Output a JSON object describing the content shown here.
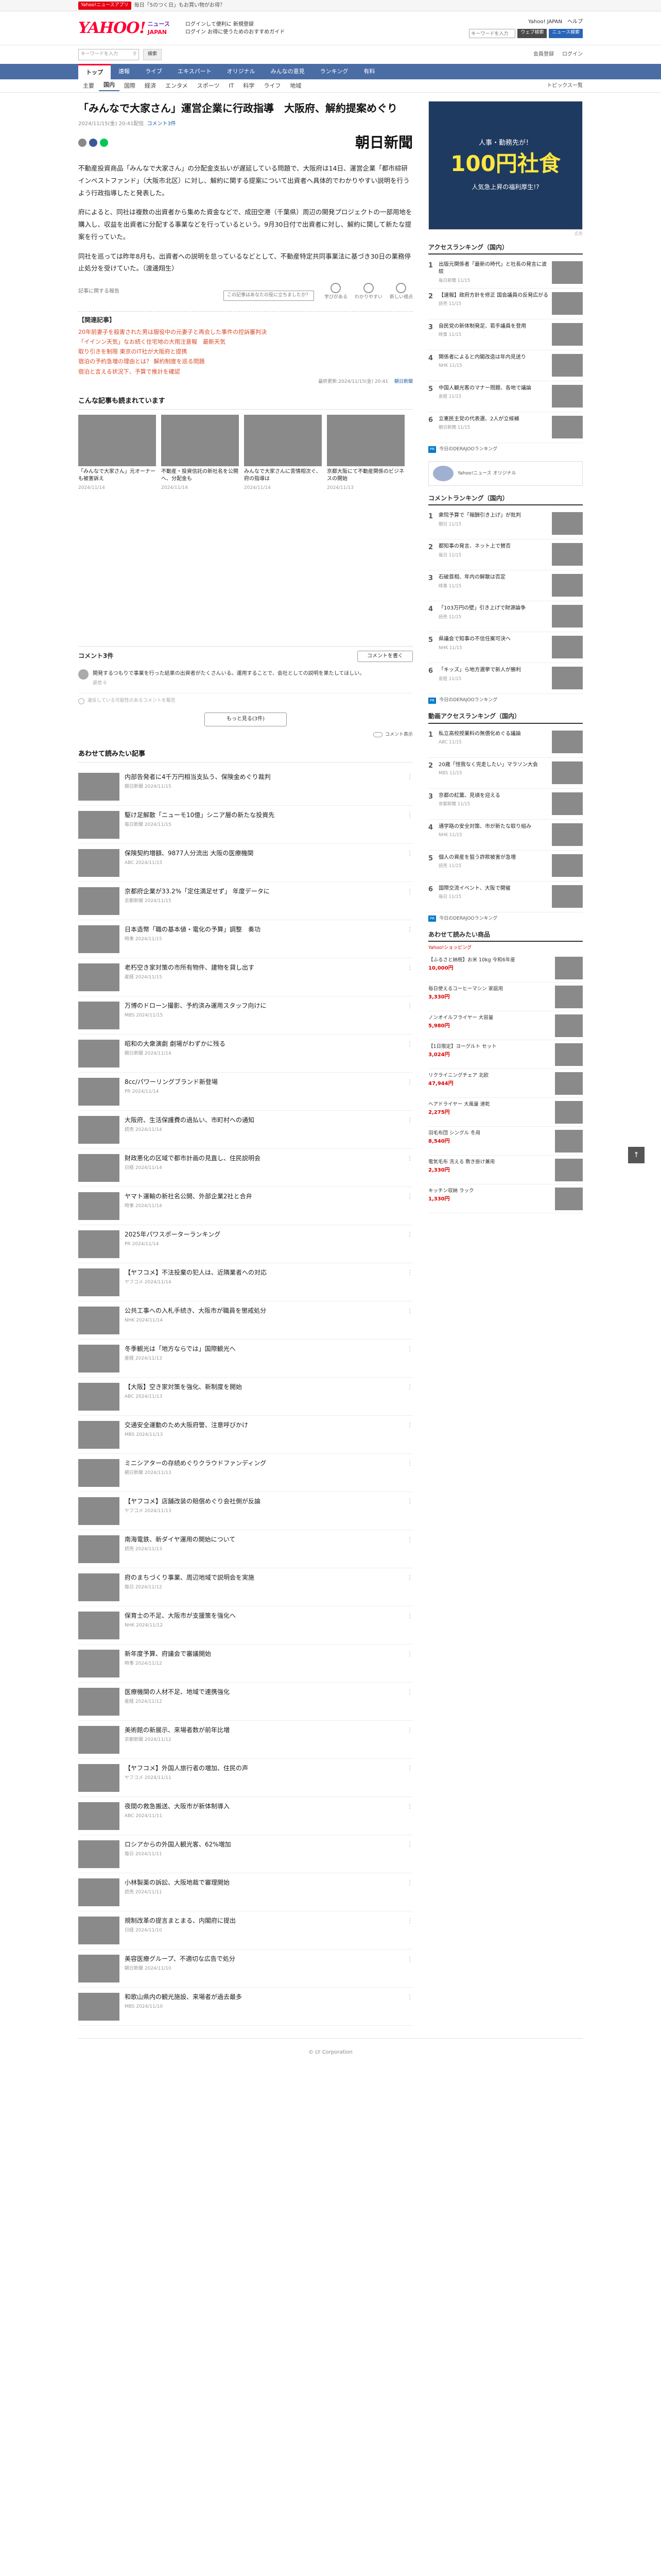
{
  "topbar": {
    "badge": "Yahoo!ニュースアプリ",
    "promo": "毎日「5のつく日」もお買い物がお得？"
  },
  "header": {
    "logo": "YAHOO!",
    "logo_sub1": "ニュース",
    "logo_sub2": "JAPAN",
    "mid_line1": "ログインして便利に 新規登録",
    "mid_line2": "ログイン  お得に使うためのおすすめガイド",
    "links": [
      "Yahoo! JAPAN",
      "ヘルプ"
    ],
    "search_placeholder": "キーワードを入力",
    "search_web": "ウェブ検索",
    "search_news": "ニュース検索"
  },
  "searchrow": {
    "placeholder": "キーワードを入力",
    "button": "検索",
    "right": [
      "会員登録",
      "ログイン"
    ]
  },
  "nav": [
    "トップ",
    "速報",
    "ライブ",
    "エキスパート",
    "オリジナル",
    "みんなの意見",
    "ランキング",
    "有料"
  ],
  "subnav": [
    "主要",
    "国内",
    "国際",
    "経済",
    "エンタメ",
    "スポーツ",
    "IT",
    "科学",
    "ライフ",
    "地域"
  ],
  "subnav_right": "トピックス一覧",
  "article": {
    "title": "「みんなで大家さん」運営企業に行政指導　大阪府、解約提案めぐり",
    "time": "2024/11/15(金) 20:41配信",
    "comments": "コメント3件",
    "publisher": "朝日新聞",
    "paragraphs": [
      "不動産投資商品「みんなで大家さん」の分配金支払いが遅延している問題で、大阪府は14日、運営企業「都市綜研インベストファンド」（大阪市北区）に対し、解約に関する提案について出資者へ具体的でわかりやすい説明を行うよう行政指導したと発表した。",
      "府によると、同社は複数の出資者から集めた資金などで、成田空港（千葉県）周辺の開発プロジェクトの一部用地を購入し、収益を出資者に分配する事業などを行っているという。9月30日付で出資者に対し、解約に関して新たな提案を行っていた。",
      "同社を巡っては昨年8月も、出資者への説明を怠っているなどとして、不動産特定共同事業法に基づき30日の業務停止処分を受けていた。（渡邊翔生）"
    ],
    "byline": "朝日新聞社",
    "tool": "記事に関する報告",
    "tooltip": "この記事はあなたの役に立ちましたか？",
    "reactions": [
      "学びがある",
      "わかりやすい",
      "新しい視点"
    ],
    "related_title": "【関連記事】",
    "related": [
      "20年前妻子を殺害された男は服役中の元妻子と再会した事件の控訴審判決",
      "「イインン天気」なお続く住宅地の大雨注意報　最新天気",
      "取り引きを制限 東京のIT社が大阪府と提携",
      "宿泊の予約急増の理由とは？ 解約制度を巡る問題",
      "宿泊と言える状況下、予算で推計を確認"
    ],
    "related_date": "最終更新:2024/11/15(金) 20:41",
    "related_pub": "朝日新聞"
  },
  "recommend": {
    "title": "こんな記事も読まれています",
    "cards": [
      {
        "t": "「みんなで大家さん」元オーナーも被害訴え",
        "m": "2024/11/14"
      },
      {
        "t": "不動産・投資信託の新社名を公開へ、分配金も",
        "m": "2024/11/14"
      },
      {
        "t": "みんなで大家さんに苦情相次ぐ、府の指導は",
        "m": "2024/11/14"
      },
      {
        "t": "京都大阪にて不動産関係のビジネスの開始",
        "m": "2024/11/13"
      }
    ]
  },
  "comments": {
    "title": "コメント3件",
    "button": "コメントを書く",
    "item": "開発するつもりで事業を行った結果の出資者がたくさんいる。運用することで、会社としての説明を果たしてほしい。",
    "item_meta": "返信 0",
    "more": "もっと見る(3件)",
    "note": "違反している可能性のあるコメントを報告",
    "toggle": "コメント表示"
  },
  "feed": {
    "title": "あわせて読みたい記事",
    "items": [
      {
        "t": "内部告発者に4千万円相当支払う、保険金めぐり裁判",
        "m": "朝日新聞 2024/11/15"
      },
      {
        "t": "駆け足解散「ニューモ10億」シニア層の新たな投資先",
        "m": "毎日新聞 2024/11/15"
      },
      {
        "t": "保険契約増額、9877人分流出 大阪の医療機関",
        "m": "ABC 2024/11/15"
      },
      {
        "t": "京都府企業が33.2%「定住満足せず」 年度データに",
        "m": "京都新聞 2024/11/15"
      },
      {
        "t": "日本造幣「職の基本値・電化の予算」調整　奏功",
        "m": "時事 2024/11/15"
      },
      {
        "t": "老朽空き家対策の市所有物件、建物を貸し出す",
        "m": "産経 2024/11/15"
      },
      {
        "t": "万博のドローン撮影、予約済み運用スタッフ向けに",
        "m": "MBS 2024/11/15"
      },
      {
        "t": "昭和の大衆演劇 劇場がわずかに残る",
        "m": "朝日新聞 2024/11/14"
      },
      {
        "t": "8cc/パワーリングブランド新登場",
        "m": "PR 2024/11/14"
      },
      {
        "t": "大阪府、生活保護費の過払い、市町村への通知",
        "m": "読売 2024/11/14"
      },
      {
        "t": "財政悪化の区域で都市計画の見直し、住民説明会",
        "m": "日経 2024/11/14"
      },
      {
        "t": "ヤマト運輸の新社名公開、外部企業2社と合弁",
        "m": "時事 2024/11/14"
      },
      {
        "t": "2025年パワスポーターランキング",
        "m": "PR 2024/11/14"
      },
      {
        "t": "【ヤフコメ】不法投棄の犯人は、近隣業者への対応",
        "m": "ヤフコメ 2024/11/14"
      },
      {
        "t": "公共工事への入札手続き、大阪市が職員を懲戒処分",
        "m": "NHK 2024/11/14"
      },
      {
        "t": "冬季観光は「地方ならでは」国際観光へ",
        "m": "産経 2024/11/13"
      },
      {
        "t": "【大阪】空き家対策を強化、新制度を開始",
        "m": "ABC 2024/11/13"
      },
      {
        "t": "交通安全運動のため大阪府警、注意呼びかけ",
        "m": "MBS 2024/11/13"
      },
      {
        "t": "ミニシアターの存続めぐりクラウドファンディング",
        "m": "朝日新聞 2024/11/13"
      },
      {
        "t": "【ヤフコメ】店舗改装の賠償めぐり会社側が反論",
        "m": "ヤフコメ 2024/11/13"
      },
      {
        "t": "南海電鉄、新ダイヤ運用の開始について",
        "m": "読売 2024/11/13"
      },
      {
        "t": "府のまちづくり事業、周辺地域で説明会を実施",
        "m": "毎日 2024/11/12"
      },
      {
        "t": "保育士の不足、大阪市が支援策を強化へ",
        "m": "NHK 2024/11/12"
      },
      {
        "t": "新年度予算、府議会で審議開始",
        "m": "時事 2024/11/12"
      },
      {
        "t": "医療機関の人材不足、地域で連携強化",
        "m": "産経 2024/11/12"
      },
      {
        "t": "美術館の新展示、来場者数が前年比増",
        "m": "京都新聞 2024/11/12"
      },
      {
        "t": "【ヤフコメ】外国人旅行者の増加、住民の声",
        "m": "ヤフコメ 2024/11/11"
      },
      {
        "t": "夜間の救急搬送、大阪市が新体制導入",
        "m": "ABC 2024/11/11"
      },
      {
        "t": "ロシアからの外国人観光客、62%増加",
        "m": "毎日 2024/11/11"
      },
      {
        "t": "小林製薬の訴訟、大阪地裁で審理開始",
        "m": "読売 2024/11/11"
      },
      {
        "t": "規制改革の提言まとまる、内閣府に提出",
        "m": "日経 2024/11/10"
      },
      {
        "t": "美容医療グループ、不適切な広告で処分",
        "m": "朝日新聞 2024/11/10"
      },
      {
        "t": "和歌山県内の観光施設、来場者が過去最多",
        "m": "MBS 2024/11/10"
      }
    ]
  },
  "sidebar": {
    "ad": {
      "top": "人事・勤務先が！",
      "big": "100円社食",
      "sub": "人気急上昇の福利厚生!?",
      "label": "広告"
    },
    "access_national": {
      "title": "アクセスランキング（国内）",
      "items": [
        {
          "t": "出版元関係者「最新の時代」と社長の発言に波紋",
          "m": "毎日新聞 11/15"
        },
        {
          "t": "【速報】政府方針を修正 国会議員の反発広がる",
          "m": "読売 11/15"
        },
        {
          "t": "自民党の新体制発足、若手議員を登用",
          "m": "時事 11/15"
        },
        {
          "t": "関係者によると内閣改造は年内見送り",
          "m": "NHK 11/15"
        },
        {
          "t": "中国人観光客のマナー問題、各地で議論",
          "m": "産経 11/15"
        },
        {
          "t": "立憲民主党の代表選、2人が立候補",
          "m": "朝日新聞 11/15"
        }
      ],
      "foot": "今日のDERAJOOランキング"
    },
    "promo": "Yahoo!ニュース オリジナル",
    "comment_rank": {
      "title": "コメントランキング（国内）",
      "items": [
        {
          "t": "衆院予算で「報酬引き上げ」が批判",
          "m": "朝日 11/15"
        },
        {
          "t": "都知事の発言、ネット上で賛否",
          "m": "毎日 11/15"
        },
        {
          "t": "石破首相、年内の解散は否定",
          "m": "時事 11/15"
        },
        {
          "t": "「103万円の壁」引き上げで財源論争",
          "m": "読売 11/15"
        },
        {
          "t": "県議会で知事の不信任案可決へ",
          "m": "NHK 11/15"
        },
        {
          "t": "「キッズ」ら地方選挙で新人が勝利",
          "m": "産経 11/15"
        }
      ],
      "foot": "今日のDERAJOOランキング"
    },
    "access_topics": {
      "title": "動画アクセスランキング（国内）",
      "items": [
        {
          "t": "私立高校授業料の無償化めぐる議論",
          "m": "ABC 11/15"
        },
        {
          "t": "20歳「怪我なく完走したい」マラソン大会",
          "m": "MBS 11/15"
        },
        {
          "t": "京都の紅葉、見頃を迎える",
          "m": "京都新聞 11/15"
        },
        {
          "t": "通学路の安全対策、市が新たな取り組み",
          "m": "NHK 11/15"
        },
        {
          "t": "個人の資産を狙う詐欺被害が急増",
          "m": "読売 11/15"
        },
        {
          "t": "国際交流イベント、大阪で開催",
          "m": "毎日 11/15"
        }
      ],
      "foot": "今日のDERAJOOランキング"
    },
    "shop": {
      "title": "あわせて読みたい商品",
      "sub": "Yahoo!ショッピング",
      "items": [
        {
          "t": "【ふるさと納税】お米 10kg 令和6年産",
          "p": "10,000円"
        },
        {
          "t": "毎日使えるコーヒーマシン 家庭用",
          "p": "3,330円"
        },
        {
          "t": "ノンオイルフライヤー 大容量",
          "p": "5,980円"
        },
        {
          "t": "【1日限定】ヨーグルト セット",
          "p": "3,024円"
        },
        {
          "t": "リクライニングチェア 北欧",
          "p": "47,944円"
        },
        {
          "t": "ヘアドライヤー 大風量 速乾",
          "p": "2,275円"
        },
        {
          "t": "羽毛布団 シングル 冬用",
          "p": "8,540円"
        },
        {
          "t": "電気毛布 洗える 敷き掛け兼用",
          "p": "2,330円"
        },
        {
          "t": "キッチン収納 ラック",
          "p": "1,330円"
        }
      ]
    }
  },
  "pagetop": "↑",
  "footer": "© LY Corporation"
}
